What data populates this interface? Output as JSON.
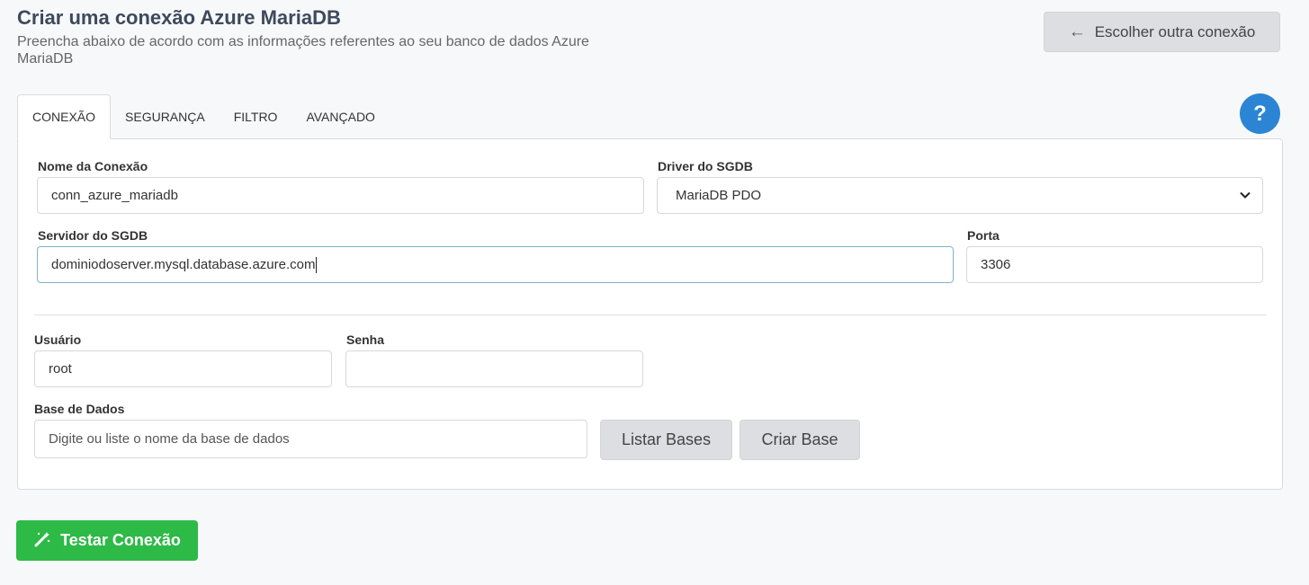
{
  "header": {
    "title": "Criar uma conexão Azure MariaDB",
    "subtitle": "Preencha abaixo de acordo com as informações referentes ao seu banco de dados Azure MariaDB",
    "back_label": "Escolher outra conexão",
    "back_icon": "arrow-left-icon"
  },
  "tabs": [
    {
      "label": "CONEXÃO",
      "active": true
    },
    {
      "label": "SEGURANÇA"
    },
    {
      "label": "FILTRO"
    },
    {
      "label": "AVANÇADO"
    }
  ],
  "help": {
    "label": "?"
  },
  "form": {
    "connection_name": {
      "label": "Nome da Conexão",
      "value": "conn_azure_mariadb"
    },
    "driver": {
      "label": "Driver do SGDB",
      "value": "MariaDB PDO"
    },
    "server": {
      "label": "Servidor do SGDB",
      "value": "dominiodoserver.mysql.database.azure.com"
    },
    "port": {
      "label": "Porta",
      "value": "3306"
    },
    "user": {
      "label": "Usuário",
      "value": "root"
    },
    "password": {
      "label": "Senha",
      "value": ""
    },
    "database": {
      "label": "Base de Dados",
      "placeholder": "Digite ou liste o nome da base de dados"
    },
    "list_bases_label": "Listar Bases",
    "create_base_label": "Criar Base"
  },
  "footer": {
    "test_label": "Testar Conexão",
    "test_icon": "magic-wand-icon"
  },
  "colors": {
    "primary_green": "#2dba47",
    "help_blue": "#2b85d4",
    "button_gray": "#dcdee1"
  }
}
